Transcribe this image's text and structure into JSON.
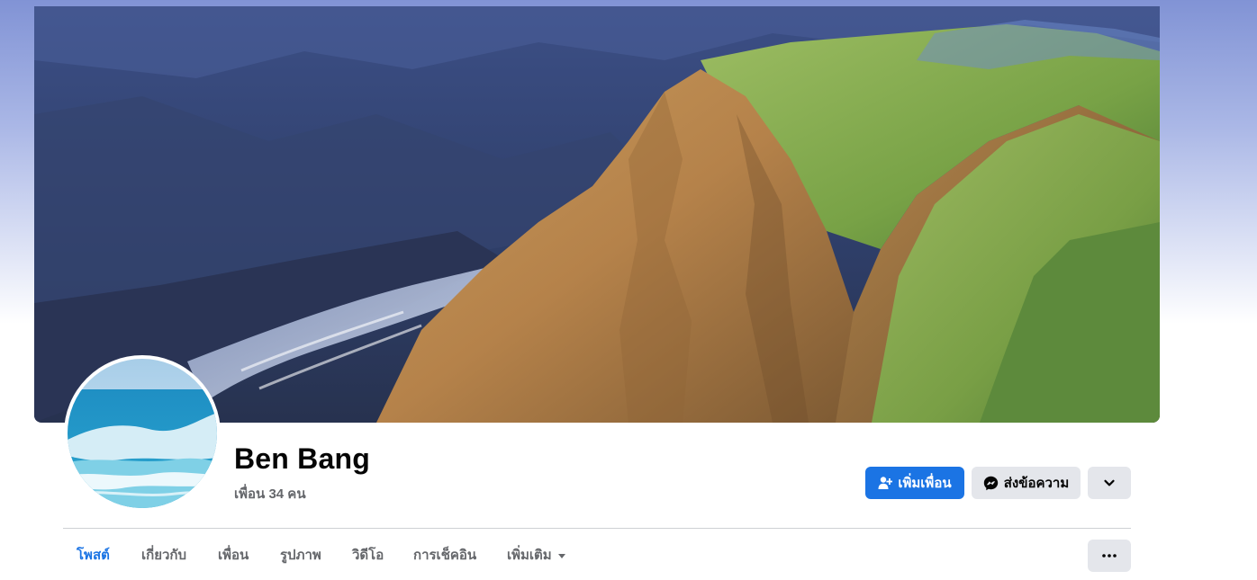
{
  "profile": {
    "name": "Ben Bang",
    "friends_text": "เพื่อน 34 คน"
  },
  "actions": {
    "add_friend_label": "เพิ่มเพื่อน",
    "message_label": "ส่งข้อความ"
  },
  "tabs": [
    {
      "label": "โพสต์",
      "active": true
    },
    {
      "label": "เกี่ยวกับ",
      "active": false
    },
    {
      "label": "เพื่อน",
      "active": false
    },
    {
      "label": "รูปภาพ",
      "active": false
    },
    {
      "label": "วิดีโอ",
      "active": false
    },
    {
      "label": "การเช็คอิน",
      "active": false
    },
    {
      "label": "เพิ่มเติม",
      "active": false
    }
  ],
  "icons": {
    "add_friend": "person-add-icon",
    "message": "messenger-icon",
    "dropdown": "chevron-down-icon",
    "more_tab_caret": "caret-down-icon",
    "tab_options": "ellipsis-icon"
  },
  "colors": {
    "primary": "#1b74e4",
    "secondary_button": "#e4e6eb",
    "text_primary": "#050505",
    "text_secondary": "#65676b",
    "divider": "#ced0d4"
  }
}
